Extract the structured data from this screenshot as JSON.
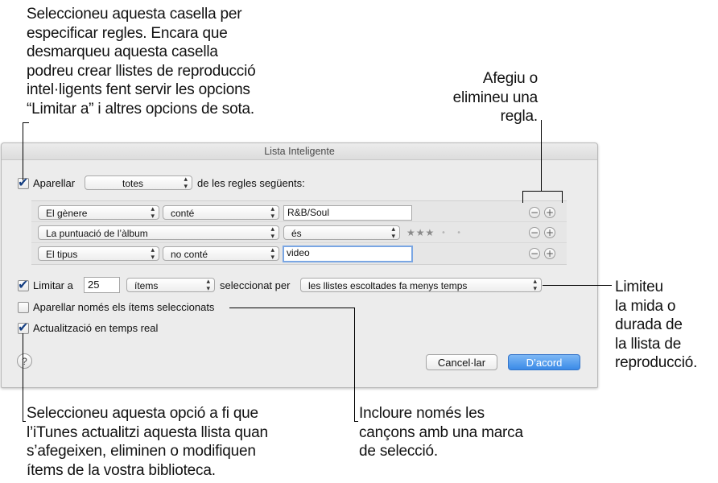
{
  "callouts": {
    "top_left": [
      "Seleccioneu aquesta casella per",
      "especificar regles. Encara que",
      "desmarqueu aquesta casella",
      "podreu crear llistes de reproducció",
      "intel·ligents fent servir les opcions",
      "“Limitar a” i altres opcions de sota."
    ],
    "top_right": [
      "Afegiu o",
      "elimineu una",
      "regla."
    ],
    "right": [
      "Limiteu",
      "la mida o",
      "durada de",
      "la llista de",
      "reproducció."
    ],
    "bottom_left": [
      "Seleccioneu aquesta opció a fi que",
      "l’iTunes actualitzi aquesta llista quan",
      "s’afegeixen, eliminen o modifiquen",
      "ítems de la vostra biblioteca."
    ],
    "bottom_mid": [
      "Incloure només les",
      "cançons amb una marca",
      "de selecció."
    ]
  },
  "dialog": {
    "title": "Lista Inteligente",
    "match_label": "Aparellar",
    "match_value": "totes",
    "match_suffix": "de les regles següents:",
    "rules": [
      {
        "field": "El gènere",
        "operator": "conté",
        "value": "R&B/Soul"
      },
      {
        "field": "La puntuació de l’àlbum",
        "operator": "és",
        "rating_stars": "★★★",
        "rating_dots": "• •"
      },
      {
        "field": "El tipus",
        "operator": "no conté",
        "value": "video"
      }
    ],
    "limit_label": "Limitar a",
    "limit_value": "25",
    "limit_unit": "ítems",
    "selected_by_label": "seleccionat per",
    "selected_by_value": "les llistes escoltades fa menys temps",
    "match_checked_label": "Aparellar només els ítems seleccionats",
    "live_update_label": "Actualització en temps real",
    "help_label": "?",
    "cancel_label": "Cancel·lar",
    "ok_label": "D’acord",
    "minus_label": "−",
    "plus_label": "+"
  },
  "colors": {
    "accent": "#3a8ae7",
    "checkmark": "#163f82",
    "focus_ring": "#7aa6e3"
  }
}
